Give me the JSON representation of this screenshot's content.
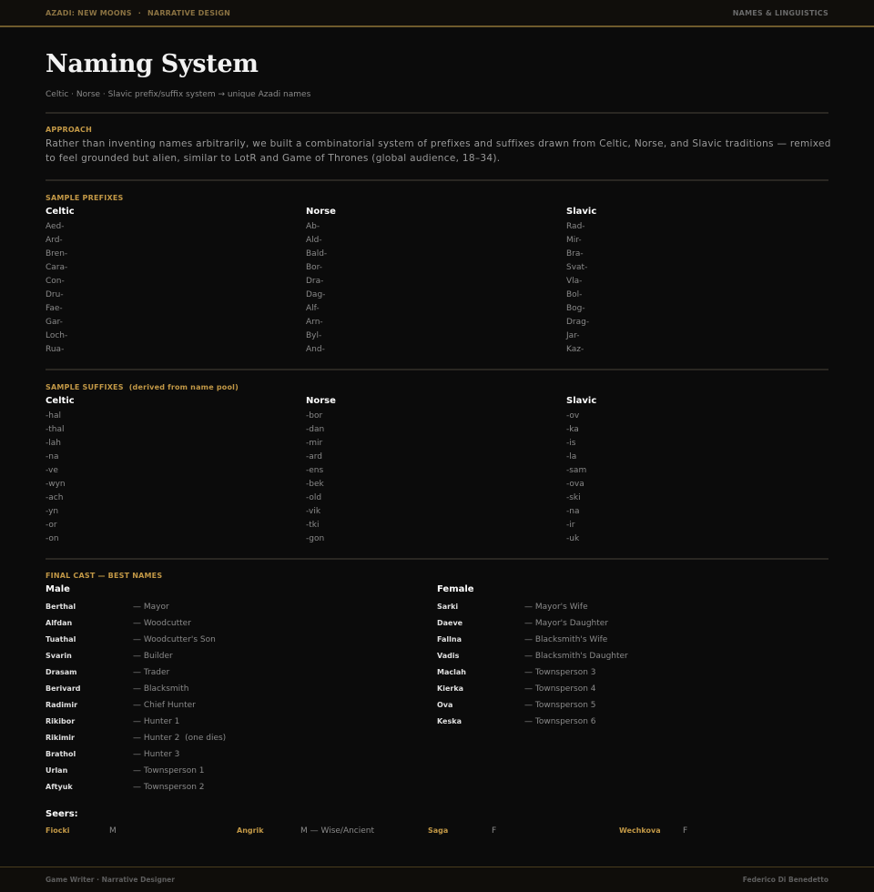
{
  "header": {
    "brand": "AZADI: NEW MOONS",
    "separator": "·",
    "section": "NARRATIVE DESIGN",
    "right": "NAMES & LINGUISTICS"
  },
  "page": {
    "title": "Naming System",
    "subtitle": "Celtic · Norse · Slavic prefix/suffix system → unique Azadi names"
  },
  "approach": {
    "label": "APPROACH",
    "text": "Rather than inventing names arbitrarily, we built a combinatorial system of prefixes and suffixes drawn from Celtic, Norse, and Slavic traditions — remixed to feel grounded but alien, similar to LotR and Game of Thrones (global audience, 18–34)."
  },
  "prefixes": {
    "label": "SAMPLE PREFIXES",
    "columns": [
      {
        "heading": "Celtic",
        "items": [
          "Aed-",
          "Ard-",
          "Bren-",
          "Cara-",
          "Con-",
          "Dru-",
          "Fae-",
          "Gar-",
          "Loch-",
          "Rua-"
        ]
      },
      {
        "heading": "Norse",
        "items": [
          "Ab-",
          "Ald-",
          "Bald-",
          "Bor-",
          "Dra-",
          "Dag-",
          "Alf-",
          "Arn-",
          "Byl-",
          "And-"
        ]
      },
      {
        "heading": "Slavic",
        "items": [
          "Rad-",
          "Mir-",
          "Bra-",
          "Svat-",
          "Vla-",
          "Bol-",
          "Bog-",
          "Drag-",
          "Jar-",
          "Kaz-"
        ]
      }
    ]
  },
  "suffixes": {
    "label": "SAMPLE SUFFIXES",
    "label_extra": "(derived from name pool)",
    "columns": [
      {
        "heading": "Celtic",
        "items": [
          "-hal",
          "-thal",
          "-lah",
          "-na",
          "-ve",
          "-wyn",
          "-ach",
          "-yn",
          "-or",
          "-on"
        ]
      },
      {
        "heading": "Norse",
        "items": [
          "-bor",
          "-dan",
          "-mir",
          "-ard",
          "-ens",
          "-bek",
          "-old",
          "-vik",
          "-tki",
          "-gon"
        ]
      },
      {
        "heading": "Slavic",
        "items": [
          "-ov",
          "-ka",
          "-is",
          "-la",
          "-sam",
          "-ova",
          "-ski",
          "-na",
          "-ir",
          "-uk"
        ]
      }
    ]
  },
  "cast": {
    "label": "FINAL CAST — BEST NAMES",
    "male": {
      "heading": "Male",
      "rows": [
        {
          "name": "Berthal",
          "role": "— Mayor"
        },
        {
          "name": "Alfdan",
          "role": "— Woodcutter"
        },
        {
          "name": "Tuathal",
          "role": "— Woodcutter's Son"
        },
        {
          "name": "Svarin",
          "role": "— Builder"
        },
        {
          "name": "Drasam",
          "role": "— Trader"
        },
        {
          "name": "Berivard",
          "role": "— Blacksmith"
        },
        {
          "name": "Radimir",
          "role": "— Chief Hunter"
        },
        {
          "name": "Rikibor",
          "role": "— Hunter 1"
        },
        {
          "name": "Rikimir",
          "role": "— Hunter 2  (one dies)"
        },
        {
          "name": "Brathol",
          "role": "— Hunter 3"
        },
        {
          "name": "Urlan",
          "role": "— Townsperson 1"
        },
        {
          "name": "Aftyuk",
          "role": "— Townsperson 2"
        }
      ]
    },
    "female": {
      "heading": "Female",
      "rows": [
        {
          "name": "Sarki",
          "role": "— Mayor's Wife"
        },
        {
          "name": "Daeve",
          "role": "— Mayor's Daughter"
        },
        {
          "name": "Fallna",
          "role": "— Blacksmith's Wife"
        },
        {
          "name": "Vadis",
          "role": "— Blacksmith's Daughter"
        },
        {
          "name": "Maclah",
          "role": "— Townsperson 3"
        },
        {
          "name": "Kierka",
          "role": "— Townsperson 4"
        },
        {
          "name": "Ova",
          "role": "— Townsperson 5"
        },
        {
          "name": "Keska",
          "role": "— Townsperson 6"
        }
      ]
    }
  },
  "seers": {
    "heading": "Seers:",
    "items": [
      {
        "name": "Fiocki",
        "role": "M"
      },
      {
        "name": "Angrik",
        "role": "M — Wise/Ancient"
      },
      {
        "name": "Saga",
        "role": "F"
      },
      {
        "name": "Wechkova",
        "role": "F"
      }
    ]
  },
  "footer": {
    "left": "Game Writer · Narrative Designer",
    "right": "Federico Di Benedetto"
  }
}
